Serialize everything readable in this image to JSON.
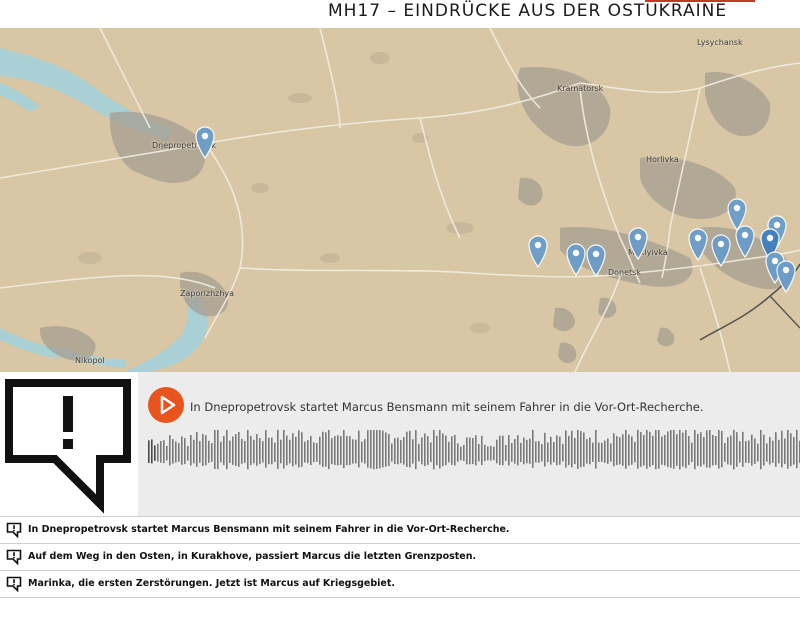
{
  "header": {
    "title": "MH17 – EINDRÜCKE AUS DER OSTUKRAINE"
  },
  "map": {
    "cities": [
      {
        "name": "Lysychansk"
      },
      {
        "name": "Kramatorsk"
      },
      {
        "name": "Dnepropetrovsk"
      },
      {
        "name": "Horlivka"
      },
      {
        "name": "Makiyivka"
      },
      {
        "name": "Donetsk"
      },
      {
        "name": "Zaporizhzhya"
      },
      {
        "name": "Nikopol"
      }
    ],
    "marker_color": "#6a9cc9",
    "active_marker_color": "#3f7fbf"
  },
  "player": {
    "now_playing": "In Dnepropetrovsk startet Marcus Bensmann mit seinem Fahrer in die Vor-Ort-Recherche.",
    "accent_color": "#e8541e",
    "icons": {
      "play": "play-icon",
      "logo": "speech-bubble-exclamation-icon"
    }
  },
  "playlist": {
    "items": [
      {
        "label": "In Dnepropetrovsk startet Marcus Bensmann mit seinem Fahrer in die Vor-Ort-Recherche."
      },
      {
        "label": "Auf dem Weg in den Osten, in Kurakhove, passiert Marcus die letzten Grenzposten."
      },
      {
        "label": "Marinka, die ersten Zerstörungen. Jetzt ist Marcus auf Kriegsgebiet."
      }
    ]
  }
}
